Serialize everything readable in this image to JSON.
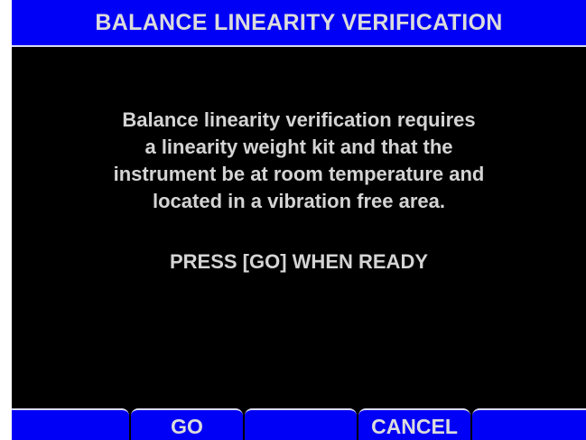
{
  "title": "BALANCE LINEARITY VERIFICATION",
  "message": {
    "lines": [
      "Balance linearity verification requires",
      "a linearity weight kit and that the",
      "instrument be at room temperature and",
      "located in a vibration free area."
    ],
    "prompt": "PRESS [GO] WHEN READY"
  },
  "softkeys": [
    "",
    "GO",
    "",
    "CANCEL",
    ""
  ],
  "colors": {
    "accent": "#0000f7",
    "background": "#000000",
    "text": "#d4d4d4"
  }
}
